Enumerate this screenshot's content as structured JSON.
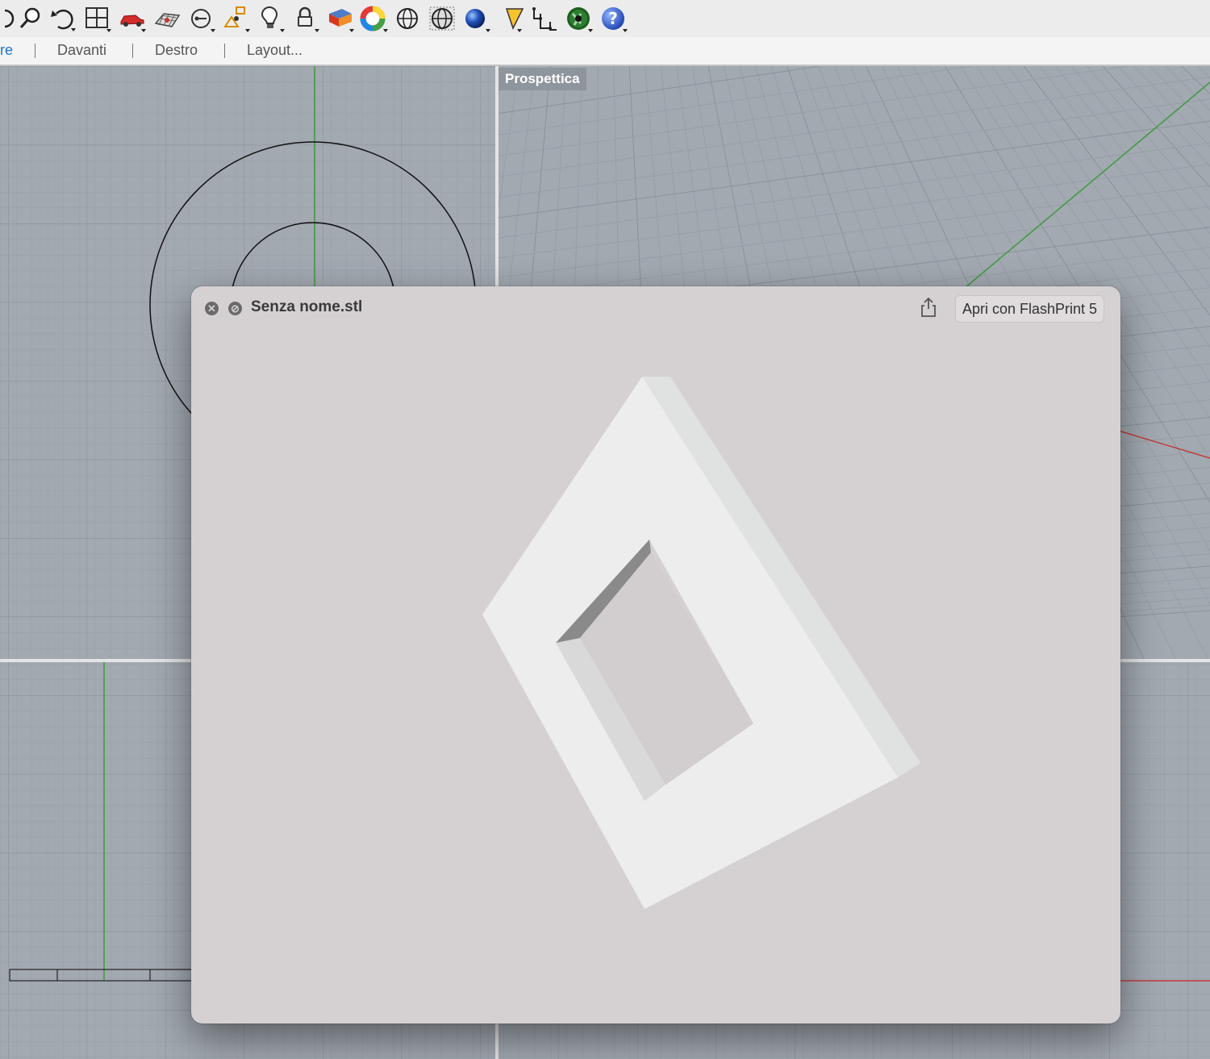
{
  "toolbar": {
    "icons": [
      "rotate-view-icon",
      "zoom-icon",
      "undo-view-icon",
      "four-viewports-icon",
      "car-render-icon",
      "grid-plane-icon",
      "circle-point-icon",
      "snap-shapes-icon",
      "light-bulb-icon",
      "lock-icon",
      "layer-color-icon",
      "color-wheel-icon",
      "sphere-wireframe-icon",
      "sphere-grid-icon",
      "blue-sphere-render-icon",
      "flag-marker-icon",
      "dimension-icon",
      "green-globe-icon",
      "help-icon"
    ]
  },
  "viewport_tabs": {
    "items": [
      {
        "label": "re",
        "active": true
      },
      {
        "label": "Davanti",
        "active": false
      },
      {
        "label": "Destro",
        "active": false
      },
      {
        "label": "Layout...",
        "active": false
      }
    ]
  },
  "viewport": {
    "perspective_label": "Prospettica"
  },
  "quicklook": {
    "title": "Senza nome.stl",
    "open_with_label": "Apri con FlashPrint 5",
    "close_icon": "close-icon",
    "fullscreen_icon": "fullscreen-icon",
    "share_icon": "share-icon"
  },
  "colors": {
    "viewport_bg": "#a2a9b1",
    "grid_line": "#959ca4",
    "axis_green": "#3f9a3f",
    "axis_red": "#c23b3b",
    "panel_bg": "#d5d1d2",
    "model_face": "#eeeeee"
  }
}
